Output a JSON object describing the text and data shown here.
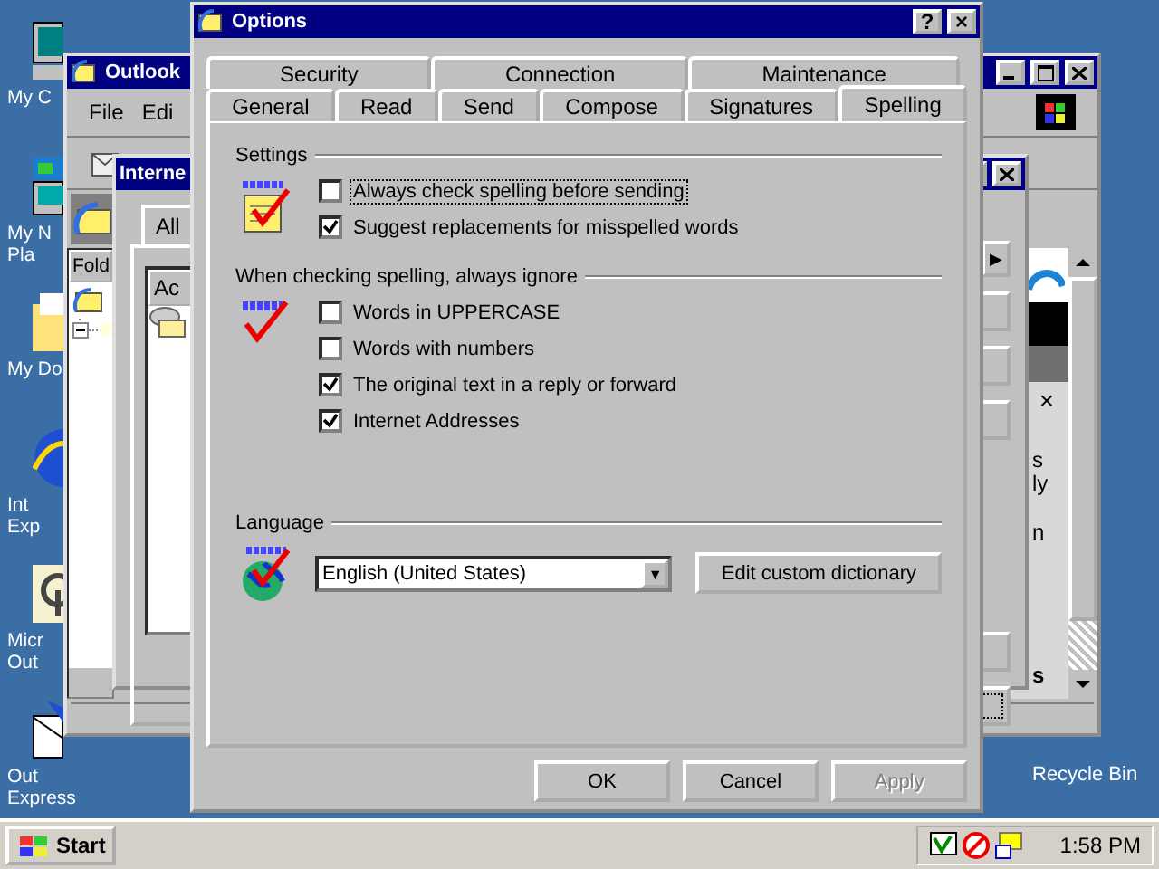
{
  "desktop_icons": [
    {
      "kind": "computer",
      "lines": [
        "My C"
      ]
    },
    {
      "kind": "network",
      "lines": [
        "My N",
        "Pla"
      ]
    },
    {
      "kind": "documents",
      "lines": [
        "My Do"
      ]
    },
    {
      "kind": "browser",
      "lines": [
        "Int",
        "Exp"
      ]
    },
    {
      "kind": "outlook",
      "lines": [
        "Micr",
        "Out"
      ]
    },
    {
      "kind": "mail",
      "lines": [
        "Out",
        "Express"
      ]
    }
  ],
  "recycle_bin": {
    "label": "Recycle Bin"
  },
  "outlook_window": {
    "title": "Outlook",
    "menu": [
      "File",
      "Edi"
    ],
    "folders_header": "Fold",
    "content_fragments": [
      "×",
      "s",
      "ly",
      "n",
      "s"
    ]
  },
  "accounts_window": {
    "title": "Interne",
    "tab": "All",
    "list_header": "Ac",
    "tab_arrow": "▶"
  },
  "options_dialog": {
    "title": "Options",
    "help": "?",
    "close": "×",
    "tab_rows": [
      {
        "tabs": [
          {
            "label": "Security",
            "selected": false
          },
          {
            "label": "Connection",
            "selected": false
          },
          {
            "label": "Maintenance",
            "selected": false
          }
        ]
      },
      {
        "tabs": [
          {
            "label": "General",
            "selected": false
          },
          {
            "label": "Read",
            "selected": false
          },
          {
            "label": "Send",
            "selected": false
          },
          {
            "label": "Compose",
            "selected": false
          },
          {
            "label": "Signatures",
            "selected": false
          },
          {
            "label": "Spelling",
            "selected": true
          }
        ]
      }
    ],
    "sections": [
      {
        "kind": "checks",
        "title": "Settings",
        "options": [
          {
            "label": "Always check spelling before sending",
            "checked": false,
            "focused": true
          },
          {
            "label": "Suggest replacements for misspelled words",
            "checked": true,
            "focused": false
          }
        ]
      },
      {
        "kind": "checks",
        "title": "When checking spelling, always ignore",
        "options": [
          {
            "label": "Words in UPPERCASE",
            "checked": false,
            "focused": false
          },
          {
            "label": "Words with numbers",
            "checked": false,
            "focused": false
          },
          {
            "label": "The original text in a reply or forward",
            "checked": true,
            "focused": false
          },
          {
            "label": "Internet Addresses",
            "checked": true,
            "focused": false
          }
        ]
      },
      {
        "kind": "language",
        "title": "Language",
        "dropdown": {
          "value": "English (United States)",
          "arrow": "▼"
        },
        "button": "Edit custom dictionary"
      }
    ],
    "buttons": [
      {
        "label": "OK",
        "disabled": false
      },
      {
        "label": "Cancel",
        "disabled": false
      },
      {
        "label": "Apply",
        "disabled": true
      }
    ]
  },
  "taskbar": {
    "start": "Start",
    "clock": "1:58 PM"
  }
}
